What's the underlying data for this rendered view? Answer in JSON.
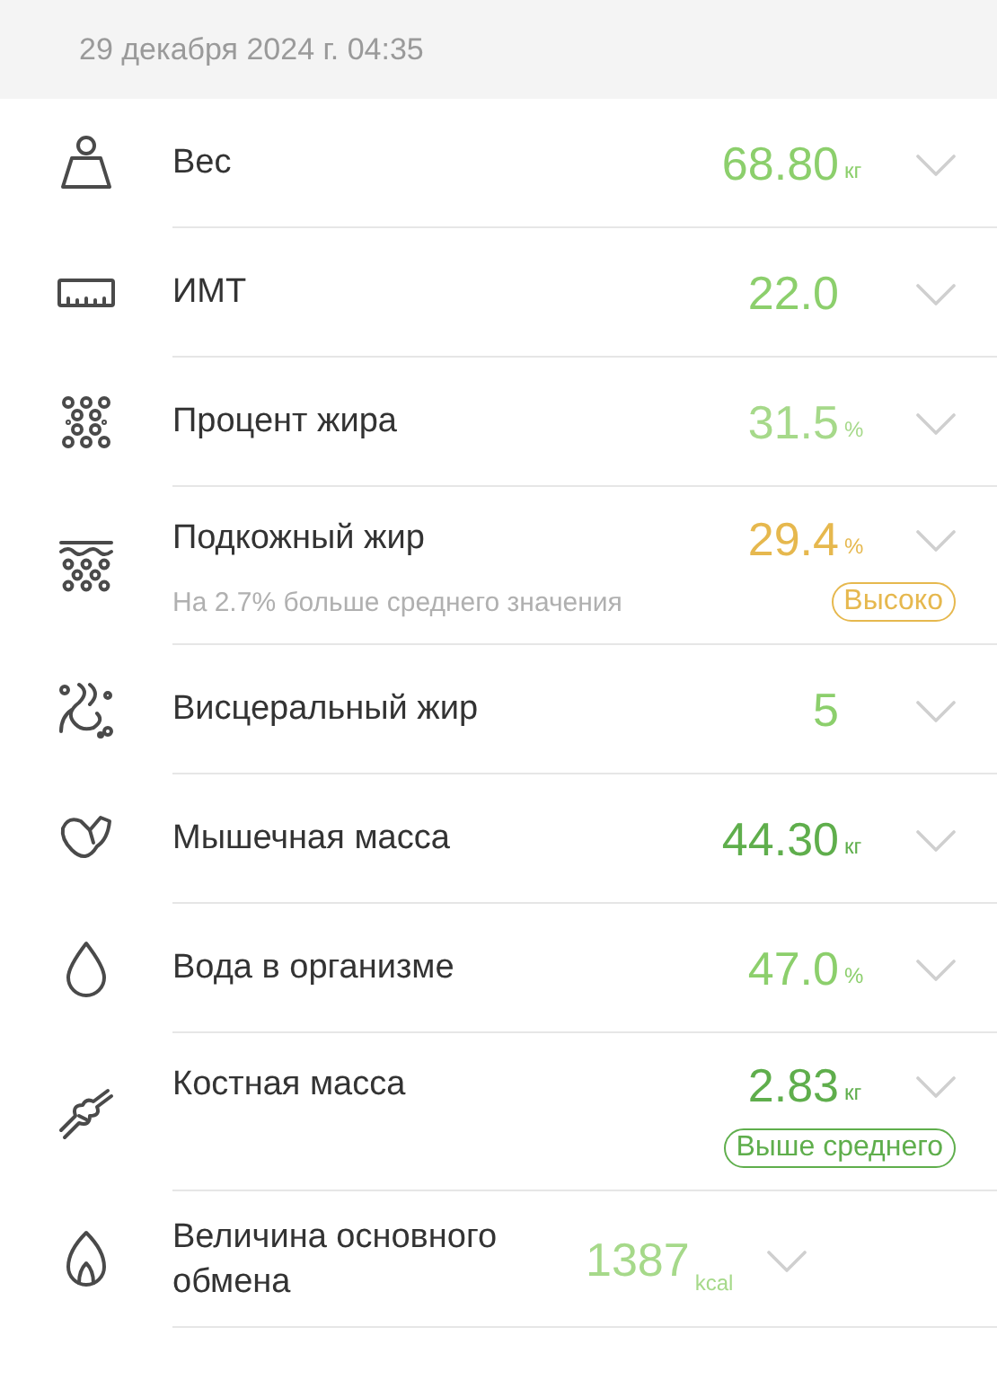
{
  "header": {
    "date": "29 декабря 2024 г. 04:35"
  },
  "metrics": [
    {
      "label": "Вес",
      "value": "68.80",
      "unit": "кг",
      "color": "#8ccf6c"
    },
    {
      "label": "ИМТ",
      "value": "22.0",
      "color": "#8ccf6c"
    },
    {
      "label": "Процент жира",
      "value": "31.5",
      "unit": "%",
      "color": "#a6d98a"
    },
    {
      "label": "Подкожный жир",
      "value": "29.4",
      "unit": "%",
      "color": "#e6b84e",
      "note": "На 2.7% больше среднего значения",
      "badge": "Высоко"
    },
    {
      "label": "Висцеральный жир",
      "value": "5",
      "color": "#8ccf6c"
    },
    {
      "label": "Мышечная масса",
      "value": "44.30",
      "unit": "кг",
      "color": "#5fae4c"
    },
    {
      "label": "Вода в организме",
      "value": "47.0",
      "unit": "%",
      "color": "#8ccf6c"
    },
    {
      "label": "Костная масса",
      "value": "2.83",
      "unit": "кг",
      "color": "#5fae4c",
      "badge": "Выше среднего"
    },
    {
      "label": "Величина основного обмена",
      "value": "1387",
      "unit": "kcal",
      "color": "#a6d98a"
    }
  ]
}
